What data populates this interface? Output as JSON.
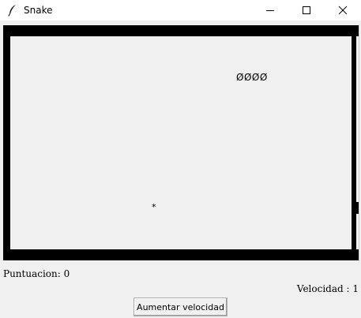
{
  "window": {
    "title": "Snake",
    "icon": "feather-icon",
    "controls": {
      "minimize": "minimize-icon",
      "maximize": "maximize-icon",
      "close": "close-icon"
    }
  },
  "game": {
    "snake": "ØØØØ",
    "food": "*"
  },
  "status": {
    "score_label": "Puntuacion: 0",
    "speed_label": "Velocidad : 1"
  },
  "controls": {
    "increase_speed_label": "Aumentar velocidad"
  }
}
